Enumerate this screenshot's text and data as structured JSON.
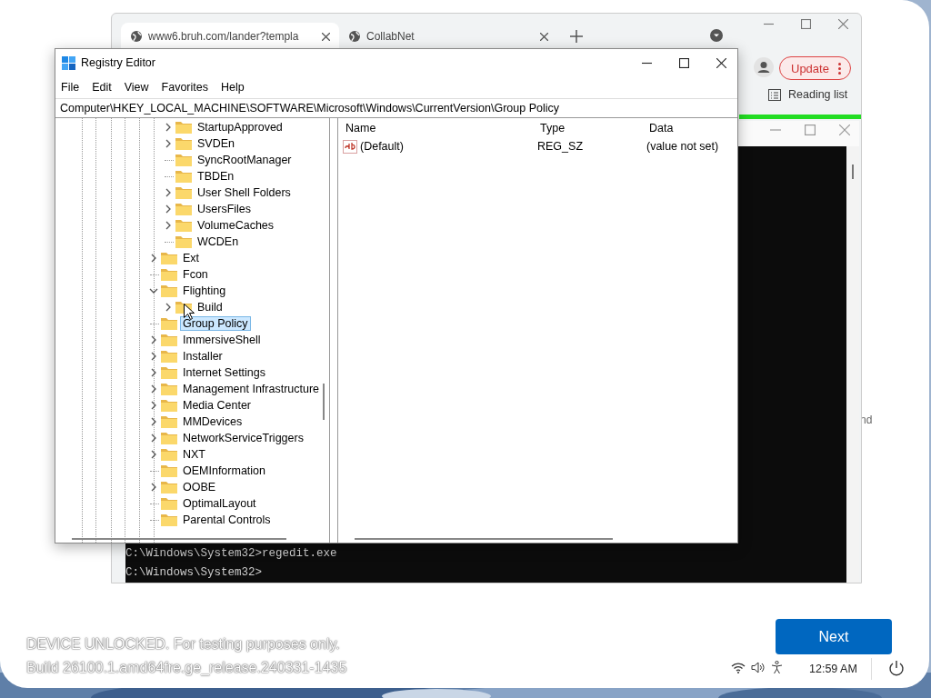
{
  "browser": {
    "tabs": [
      {
        "title": "www6.bruh.com/lander?templa",
        "selected": true
      },
      {
        "title": "CollabNet",
        "selected": false
      }
    ],
    "update_button": "Update",
    "reading_list": "Reading list"
  },
  "background_text": "nd",
  "console": {
    "lines": [
      "C:\\Windows\\System32>regedit.exe",
      "C:\\Windows\\System32>"
    ]
  },
  "registry_editor": {
    "title": "Registry Editor",
    "menu": [
      "File",
      "Edit",
      "View",
      "Favorites",
      "Help"
    ],
    "address": "Computer\\HKEY_LOCAL_MACHINE\\SOFTWARE\\Microsoft\\Windows\\CurrentVersion\\Group Policy",
    "tree": {
      "continued_children": [
        {
          "label": "StartupApproved",
          "has_children": true,
          "expanded": false,
          "selected": false
        },
        {
          "label": "SVDEn",
          "has_children": true,
          "expanded": false,
          "selected": false
        },
        {
          "label": "SyncRootManager",
          "has_children": false,
          "selected": false
        },
        {
          "label": "TBDEn",
          "has_children": false,
          "selected": false
        },
        {
          "label": "User Shell Folders",
          "has_children": true,
          "expanded": false,
          "selected": false
        },
        {
          "label": "UsersFiles",
          "has_children": true,
          "expanded": false,
          "selected": false
        },
        {
          "label": "VolumeCaches",
          "has_children": true,
          "expanded": false,
          "selected": false
        },
        {
          "label": "WCDEn",
          "has_children": false,
          "selected": false
        }
      ],
      "items": [
        {
          "label": "Ext",
          "has_children": true,
          "expanded": false,
          "selected": false
        },
        {
          "label": "Fcon",
          "has_children": false,
          "selected": false
        },
        {
          "label": "Flighting",
          "has_children": true,
          "expanded": true,
          "selected": false,
          "children": [
            {
              "label": "Build",
              "has_children": true,
              "expanded": false,
              "selected": false
            }
          ]
        },
        {
          "label": "Group Policy",
          "has_children": false,
          "selected": true
        },
        {
          "label": "ImmersiveShell",
          "has_children": true,
          "expanded": false,
          "selected": false
        },
        {
          "label": "Installer",
          "has_children": true,
          "expanded": false,
          "selected": false
        },
        {
          "label": "Internet Settings",
          "has_children": true,
          "expanded": false,
          "selected": false
        },
        {
          "label": "Management Infrastructure",
          "has_children": true,
          "expanded": false,
          "selected": false
        },
        {
          "label": "Media Center",
          "has_children": true,
          "expanded": false,
          "selected": false
        },
        {
          "label": "MMDevices",
          "has_children": true,
          "expanded": false,
          "selected": false
        },
        {
          "label": "NetworkServiceTriggers",
          "has_children": true,
          "expanded": false,
          "selected": false
        },
        {
          "label": "NXT",
          "has_children": true,
          "expanded": false,
          "selected": false
        },
        {
          "label": "OEMInformation",
          "has_children": false,
          "selected": false
        },
        {
          "label": "OOBE",
          "has_children": true,
          "expanded": false,
          "selected": false
        },
        {
          "label": "OptimalLayout",
          "has_children": false,
          "selected": false
        },
        {
          "label": "Parental Controls",
          "has_children": false,
          "selected": false
        }
      ]
    },
    "columns": [
      "Name",
      "Type",
      "Data"
    ],
    "values": [
      {
        "name": "(Default)",
        "type": "REG_SZ",
        "data": "(value not set)"
      }
    ]
  },
  "footer": {
    "notice_lines": [
      "DEVICE UNLOCKED. For testing purposes only.",
      "Build 26100.1.amd64fre.ge_release.240331-1435"
    ],
    "next_button": "Next",
    "time": "12:59 AM"
  }
}
